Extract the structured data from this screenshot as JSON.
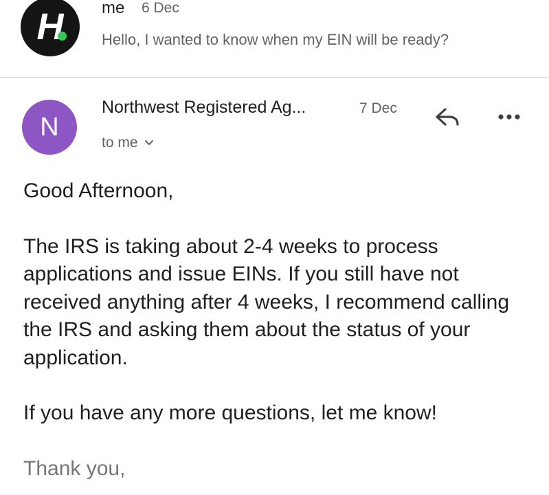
{
  "thread": {
    "collapsed_message": {
      "avatar_letter": "H",
      "sender": "me",
      "date": "6 Dec",
      "snippet": "Hello, I wanted to know when my EIN will be ready?"
    },
    "expanded_message": {
      "avatar_letter": "N",
      "avatar_color": "#8e55c5",
      "sender": "Northwest Registered Ag...",
      "date": "7 Dec",
      "recipient_label": "to me",
      "body": {
        "greeting": "Good Afternoon,",
        "paragraph_1": "The IRS is taking about 2-4 weeks to process applications and issue EINs. If you still have not received anything after 4 weeks, I recommend calling the IRS and asking them about the status of your application.",
        "paragraph_2": "If you have any more questions, let me know!",
        "signoff": "Thank you,"
      }
    },
    "icons": {
      "reply": "reply-icon",
      "more": "more-vert-icon",
      "recipient_details": "chevron-down-icon"
    }
  }
}
